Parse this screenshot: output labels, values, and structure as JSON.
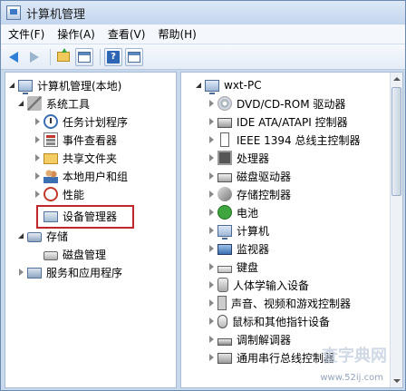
{
  "window": {
    "title": "计算机管理"
  },
  "menu": [
    {
      "label": "文件(F)"
    },
    {
      "label": "操作(A)"
    },
    {
      "label": "查看(V)"
    },
    {
      "label": "帮助(H)"
    }
  ],
  "toolbar": {
    "buttons": [
      {
        "icon": "back-arrow-icon"
      },
      {
        "icon": "forward-arrow-icon"
      },
      {
        "icon": "up-folder-icon"
      },
      {
        "icon": "show-hide-tree-icon"
      },
      {
        "icon": "help-icon"
      },
      {
        "icon": "properties-window-icon"
      }
    ]
  },
  "left_tree": {
    "items": [
      {
        "label": "计算机管理(本地)",
        "icon": "computer-icon"
      },
      {
        "label": "系统工具",
        "icon": "tools-icon"
      },
      {
        "label": "任务计划程序",
        "icon": "clock-icon"
      },
      {
        "label": "事件查看器",
        "icon": "event-viewer-icon"
      },
      {
        "label": "共享文件夹",
        "icon": "folder-icon"
      },
      {
        "label": "本地用户和组",
        "icon": "users-icon"
      },
      {
        "label": "性能",
        "icon": "performance-icon"
      },
      {
        "label": "设备管理器",
        "icon": "device-manager-icon"
      },
      {
        "label": "存储",
        "icon": "storage-icon"
      },
      {
        "label": "磁盘管理",
        "icon": "disk-icon"
      },
      {
        "label": "服务和应用程序",
        "icon": "services-icon"
      }
    ]
  },
  "right_tree": {
    "root": {
      "label": "wxt-PC",
      "icon": "computer-icon"
    },
    "items": [
      {
        "label": "DVD/CD-ROM 驱动器",
        "icon": "dvd-icon"
      },
      {
        "label": "IDE ATA/ATAPI 控制器",
        "icon": "ide-controller-icon"
      },
      {
        "label": "IEEE 1394 总线主控制器",
        "icon": "ieee1394-icon"
      },
      {
        "label": "处理器",
        "icon": "processor-icon"
      },
      {
        "label": "磁盘驱动器",
        "icon": "disk-drive-icon"
      },
      {
        "label": "存储控制器",
        "icon": "storage-controller-icon"
      },
      {
        "label": "电池",
        "icon": "battery-icon"
      },
      {
        "label": "计算机",
        "icon": "computer-icon"
      },
      {
        "label": "监视器",
        "icon": "monitor-icon"
      },
      {
        "label": "键盘",
        "icon": "keyboard-icon"
      },
      {
        "label": "人体学输入设备",
        "icon": "hid-icon"
      },
      {
        "label": "声音、视频和游戏控制器",
        "icon": "sound-icon"
      },
      {
        "label": "鼠标和其他指针设备",
        "icon": "mouse-icon"
      },
      {
        "label": "调制解调器",
        "icon": "modem-icon"
      },
      {
        "label": "通用串行总线控制器",
        "icon": "usb-icon"
      }
    ]
  },
  "watermark": {
    "main": "查字典网",
    "url": "www.52ij.com"
  },
  "colors": {
    "highlight_border": "#c0272d",
    "selection_accent": "#2f7fd8"
  }
}
